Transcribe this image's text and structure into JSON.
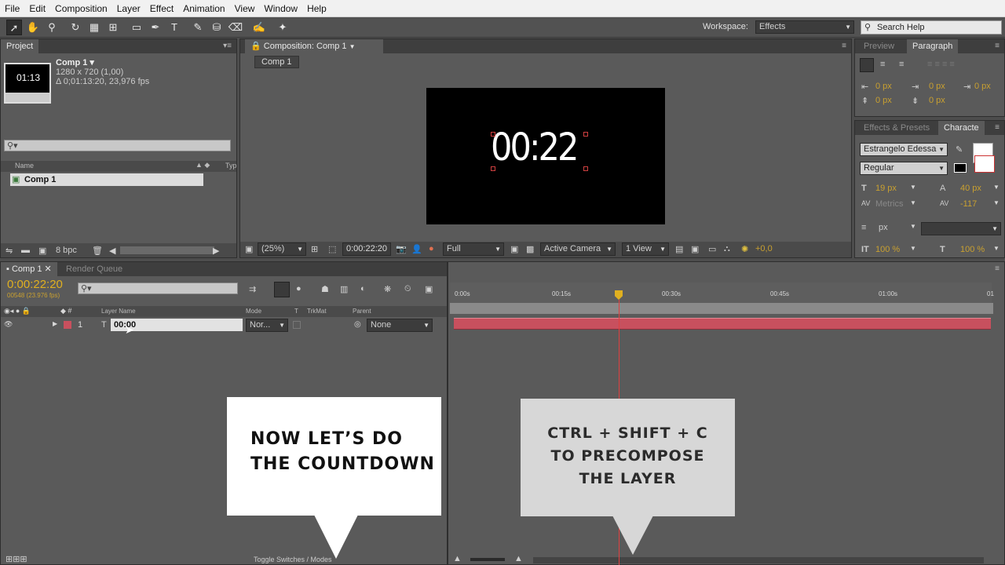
{
  "menu": [
    "File",
    "Edit",
    "Composition",
    "Layer",
    "Effect",
    "Animation",
    "View",
    "Window",
    "Help"
  ],
  "toolbar": {
    "workspace_label": "Workspace:",
    "workspace_value": "Effects",
    "search_help": "Search Help"
  },
  "project": {
    "tab": "Project",
    "comp_name": "Comp 1 ▾",
    "comp_size": "1280 x 720 (1,00)",
    "comp_duration": "Δ 0;01:13:20, 23,976 fps",
    "thumb_text": "01:13",
    "col_name": "Name",
    "col_type": "Typ",
    "item_name": "Comp 1",
    "bpc": "8 bpc"
  },
  "composition": {
    "tab": "Composition: Comp 1",
    "subtab": "Comp 1",
    "canvas_text": "00:22",
    "zoom": "(25%)",
    "timecode": "0:00:22:20",
    "resolution": "Full",
    "camera": "Active Camera",
    "views": "1 View",
    "exposure": "+0,0"
  },
  "paragraph": {
    "tab_preview": "Preview",
    "tab_paragraph": "Paragraph",
    "indent_values": [
      "0 px",
      "0 px",
      "0 px",
      "0 px",
      "0 px"
    ]
  },
  "character": {
    "tab_effects": "Effects & Presets",
    "tab_character": "Characte",
    "font": "Estrangelo Edessa",
    "style": "Regular",
    "size": "19 px",
    "leading": "40 px",
    "kerning": "Metrics",
    "tracking": "-117",
    "stroke_px": "px",
    "vscale": "100 %",
    "hscale": "100 %"
  },
  "timeline": {
    "tab_comp": "Comp 1",
    "tab_render": "Render Queue",
    "timecode": "0:00:22:20",
    "frames": "00548 (23.976 fps)",
    "col_layer_name": "Layer Name",
    "col_mode": "Mode",
    "col_t": "T",
    "col_trkmat": "TrkMat",
    "col_parent": "Parent",
    "layer_num": "1",
    "layer_name": "00:00",
    "layer_mode": "Nor...",
    "layer_parent": "None",
    "ruler": [
      "0:00s",
      "00:15s",
      "00:30s",
      "00:45s",
      "01:00s",
      "01"
    ],
    "toggle": "Toggle Switches / Modes"
  },
  "callouts": {
    "left_line1": "NOW LET’S DO",
    "left_line2": "THE COUNTDOWN",
    "right_line1": "CTRL + SHIFT + C",
    "right_line2": "TO PRECOMPOSE",
    "right_line3": "THE LAYER"
  }
}
